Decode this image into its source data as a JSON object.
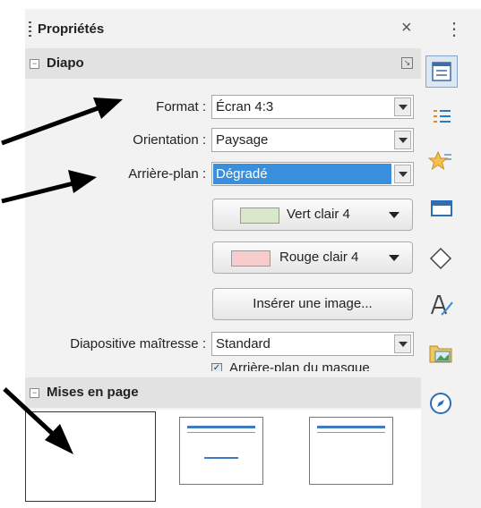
{
  "panel": {
    "title": "Propriétés",
    "close": "×",
    "menu": "⋮"
  },
  "diapo": {
    "header": "Diapo",
    "toggle": "−",
    "format_label": "Format :",
    "format_value": "Écran 4:3",
    "orientation_label": "Orientation :",
    "orientation_value": "Paysage",
    "background_label": "Arrière-plan :",
    "background_value": "Dégradé",
    "color1_label": "Vert clair 4",
    "color1_swatch": "#d8e8c8",
    "color2_label": "Rouge clair 4",
    "color2_swatch": "#f6cccc",
    "insert_image": "Insérer une image...",
    "master_label": "Diapositive maîtresse :",
    "master_value": "Standard",
    "master_bg_checkbox": "Arrière-plan du masque",
    "checkbox_mark": "✓"
  },
  "layouts": {
    "header": "Mises en page",
    "toggle": "−",
    "items": [
      "Diapositive vide",
      "Titre, contenu",
      "Titre seulement"
    ]
  },
  "tabs": [
    "properties-icon",
    "styles-icon",
    "animation-icon",
    "slide-transition-icon",
    "shapes-icon",
    "font-style-icon",
    "gallery-icon",
    "navigator-icon"
  ],
  "colors": {
    "accent": "#3a8fdc",
    "layout_bar": "#3d7bc4",
    "panel_bg": "#f2f2f2"
  }
}
